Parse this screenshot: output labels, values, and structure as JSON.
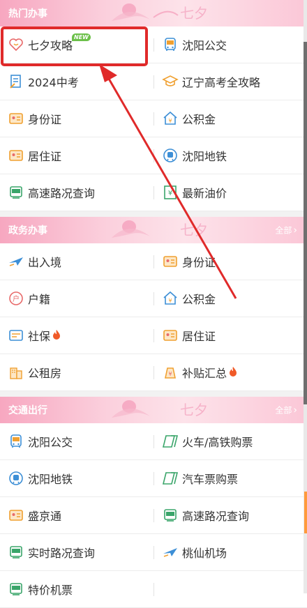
{
  "sections": {
    "hot": {
      "title": "热门办事",
      "items": [
        {
          "label": "七夕攻略",
          "icon": "heart-icon",
          "badge": "NEW"
        },
        {
          "label": "沈阳公交",
          "icon": "bus-icon"
        },
        {
          "label": "2024中考",
          "icon": "exam-paper-icon"
        },
        {
          "label": "辽宁高考全攻略",
          "icon": "graduation-cap-icon"
        },
        {
          "label": "身份证",
          "icon": "id-card-icon"
        },
        {
          "label": "公积金",
          "icon": "house-fund-icon"
        },
        {
          "label": "居住证",
          "icon": "residence-card-icon"
        },
        {
          "label": "沈阳地铁",
          "icon": "metro-icon"
        },
        {
          "label": "高速路况查询",
          "icon": "highway-icon"
        },
        {
          "label": "最新油价",
          "icon": "oil-price-icon"
        }
      ]
    },
    "gov": {
      "title": "政务办事",
      "more": "全部",
      "items": [
        {
          "label": "出入境",
          "icon": "plane-icon"
        },
        {
          "label": "身份证",
          "icon": "id-card-icon"
        },
        {
          "label": "户籍",
          "icon": "household-register-icon"
        },
        {
          "label": "公积金",
          "icon": "house-fund-icon"
        },
        {
          "label": "社保",
          "icon": "social-security-icon",
          "hot": true
        },
        {
          "label": "居住证",
          "icon": "residence-card-icon"
        },
        {
          "label": "公租房",
          "icon": "public-housing-icon"
        },
        {
          "label": "补贴汇总",
          "icon": "subsidy-bag-icon",
          "hot": true
        }
      ]
    },
    "traffic": {
      "title": "交通出行",
      "more": "全部",
      "items": [
        {
          "label": "沈阳公交",
          "icon": "bus-icon"
        },
        {
          "label": "火车/高铁购票",
          "icon": "train-ticket-icon"
        },
        {
          "label": "沈阳地铁",
          "icon": "metro-icon"
        },
        {
          "label": "汽车票购票",
          "icon": "coach-ticket-icon"
        },
        {
          "label": "盛京通",
          "icon": "transit-card-icon"
        },
        {
          "label": "高速路况查询",
          "icon": "highway-icon"
        },
        {
          "label": "实时路况查询",
          "icon": "road-status-icon"
        },
        {
          "label": "桃仙机场",
          "icon": "plane-icon"
        },
        {
          "label": "特价机票",
          "icon": "air-ticket-icon"
        },
        {
          "label": "",
          "icon": ""
        }
      ]
    }
  },
  "colors": {
    "header_gradient": "#f7a7c0",
    "highlight": "#e02a2a",
    "icon_orange": "#f0a030",
    "icon_blue": "#3d8fd6",
    "icon_green": "#3aa56a",
    "badge_green": "#6cc04a"
  }
}
